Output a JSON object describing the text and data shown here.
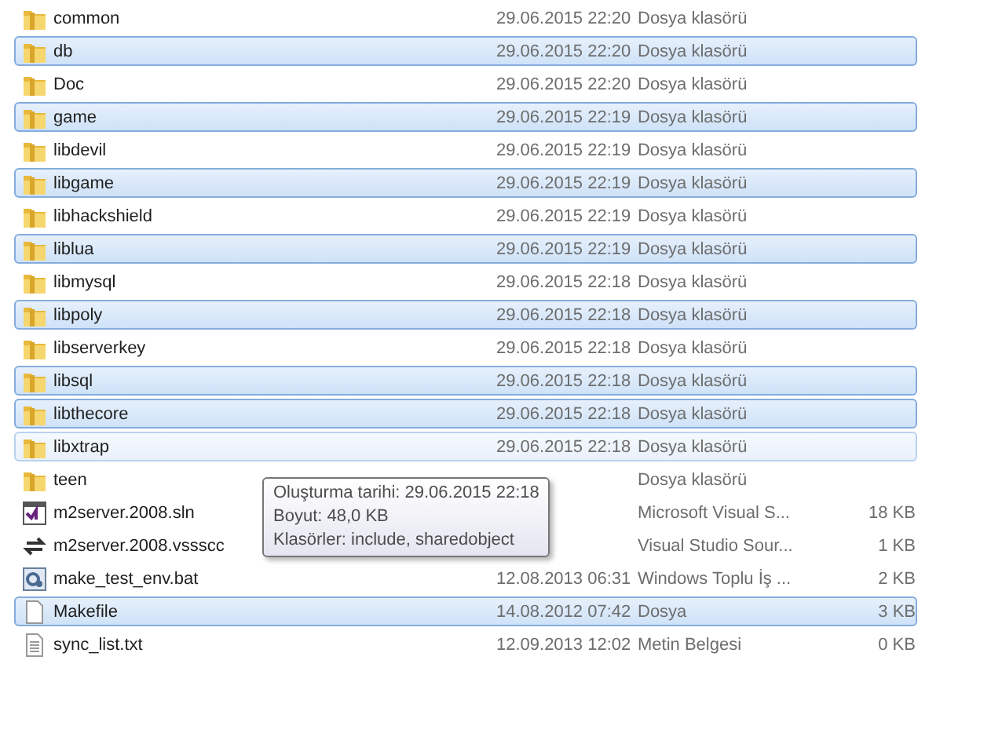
{
  "files": [
    {
      "name": "common",
      "date": "29.06.2015 22:20",
      "type": "Dosya klasörü",
      "kind": "folder",
      "selected": false,
      "hovered": false
    },
    {
      "name": "db",
      "date": "29.06.2015 22:20",
      "type": "Dosya klasörü",
      "kind": "folder",
      "selected": true,
      "hovered": false
    },
    {
      "name": "Doc",
      "date": "29.06.2015 22:20",
      "type": "Dosya klasörü",
      "kind": "folder",
      "selected": false,
      "hovered": false
    },
    {
      "name": "game",
      "date": "29.06.2015 22:19",
      "type": "Dosya klasörü",
      "kind": "folder",
      "selected": true,
      "hovered": false
    },
    {
      "name": "libdevil",
      "date": "29.06.2015 22:19",
      "type": "Dosya klasörü",
      "kind": "folder",
      "selected": false,
      "hovered": false
    },
    {
      "name": "libgame",
      "date": "29.06.2015 22:19",
      "type": "Dosya klasörü",
      "kind": "folder",
      "selected": true,
      "hovered": false
    },
    {
      "name": "libhackshield",
      "date": "29.06.2015 22:19",
      "type": "Dosya klasörü",
      "kind": "folder",
      "selected": false,
      "hovered": false
    },
    {
      "name": "liblua",
      "date": "29.06.2015 22:19",
      "type": "Dosya klasörü",
      "kind": "folder",
      "selected": true,
      "hovered": false
    },
    {
      "name": "libmysql",
      "date": "29.06.2015 22:18",
      "type": "Dosya klasörü",
      "kind": "folder",
      "selected": false,
      "hovered": false
    },
    {
      "name": "libpoly",
      "date": "29.06.2015 22:18",
      "type": "Dosya klasörü",
      "kind": "folder",
      "selected": true,
      "hovered": false
    },
    {
      "name": "libserverkey",
      "date": "29.06.2015 22:18",
      "type": "Dosya klasörü",
      "kind": "folder",
      "selected": false,
      "hovered": false
    },
    {
      "name": "libsql",
      "date": "29.06.2015 22:18",
      "type": "Dosya klasörü",
      "kind": "folder",
      "selected": true,
      "hovered": false
    },
    {
      "name": "libthecore",
      "date": "29.06.2015 22:18",
      "type": "Dosya klasörü",
      "kind": "folder",
      "selected": true,
      "hovered": false
    },
    {
      "name": "libxtrap",
      "date": "29.06.2015 22:18",
      "type": "Dosya klasörü",
      "kind": "folder",
      "selected": false,
      "hovered": true
    },
    {
      "name": "teen",
      "type": "Dosya klasörü",
      "kind": "folder",
      "selected": false,
      "hovered": false
    },
    {
      "name": "m2server.2008.sln",
      "type": "Microsoft Visual S...",
      "size": "18 KB",
      "kind": "solution",
      "selected": false,
      "hovered": false
    },
    {
      "name": "m2server.2008.vssscc",
      "type": "Visual Studio Sour...",
      "size": "1 KB",
      "kind": "sync",
      "selected": false,
      "hovered": false
    },
    {
      "name": "make_test_env.bat",
      "date": "12.08.2013 06:31",
      "type": "Windows Toplu İş ...",
      "size": "2 KB",
      "kind": "batch",
      "selected": false,
      "hovered": false
    },
    {
      "name": "Makefile",
      "date": "14.08.2012 07:42",
      "type": "Dosya",
      "size": "3 KB",
      "kind": "file",
      "selected": true,
      "hovered": false
    },
    {
      "name": "sync_list.txt",
      "date": "12.09.2013 12:02",
      "type": "Metin Belgesi",
      "size": "0 KB",
      "kind": "text",
      "selected": false,
      "hovered": false
    }
  ],
  "tooltip": {
    "lines": [
      "Oluşturma tarihi: 29.06.2015 22:18",
      "Boyut: 48,0 KB",
      "Klasörler: include, sharedobject"
    ]
  }
}
